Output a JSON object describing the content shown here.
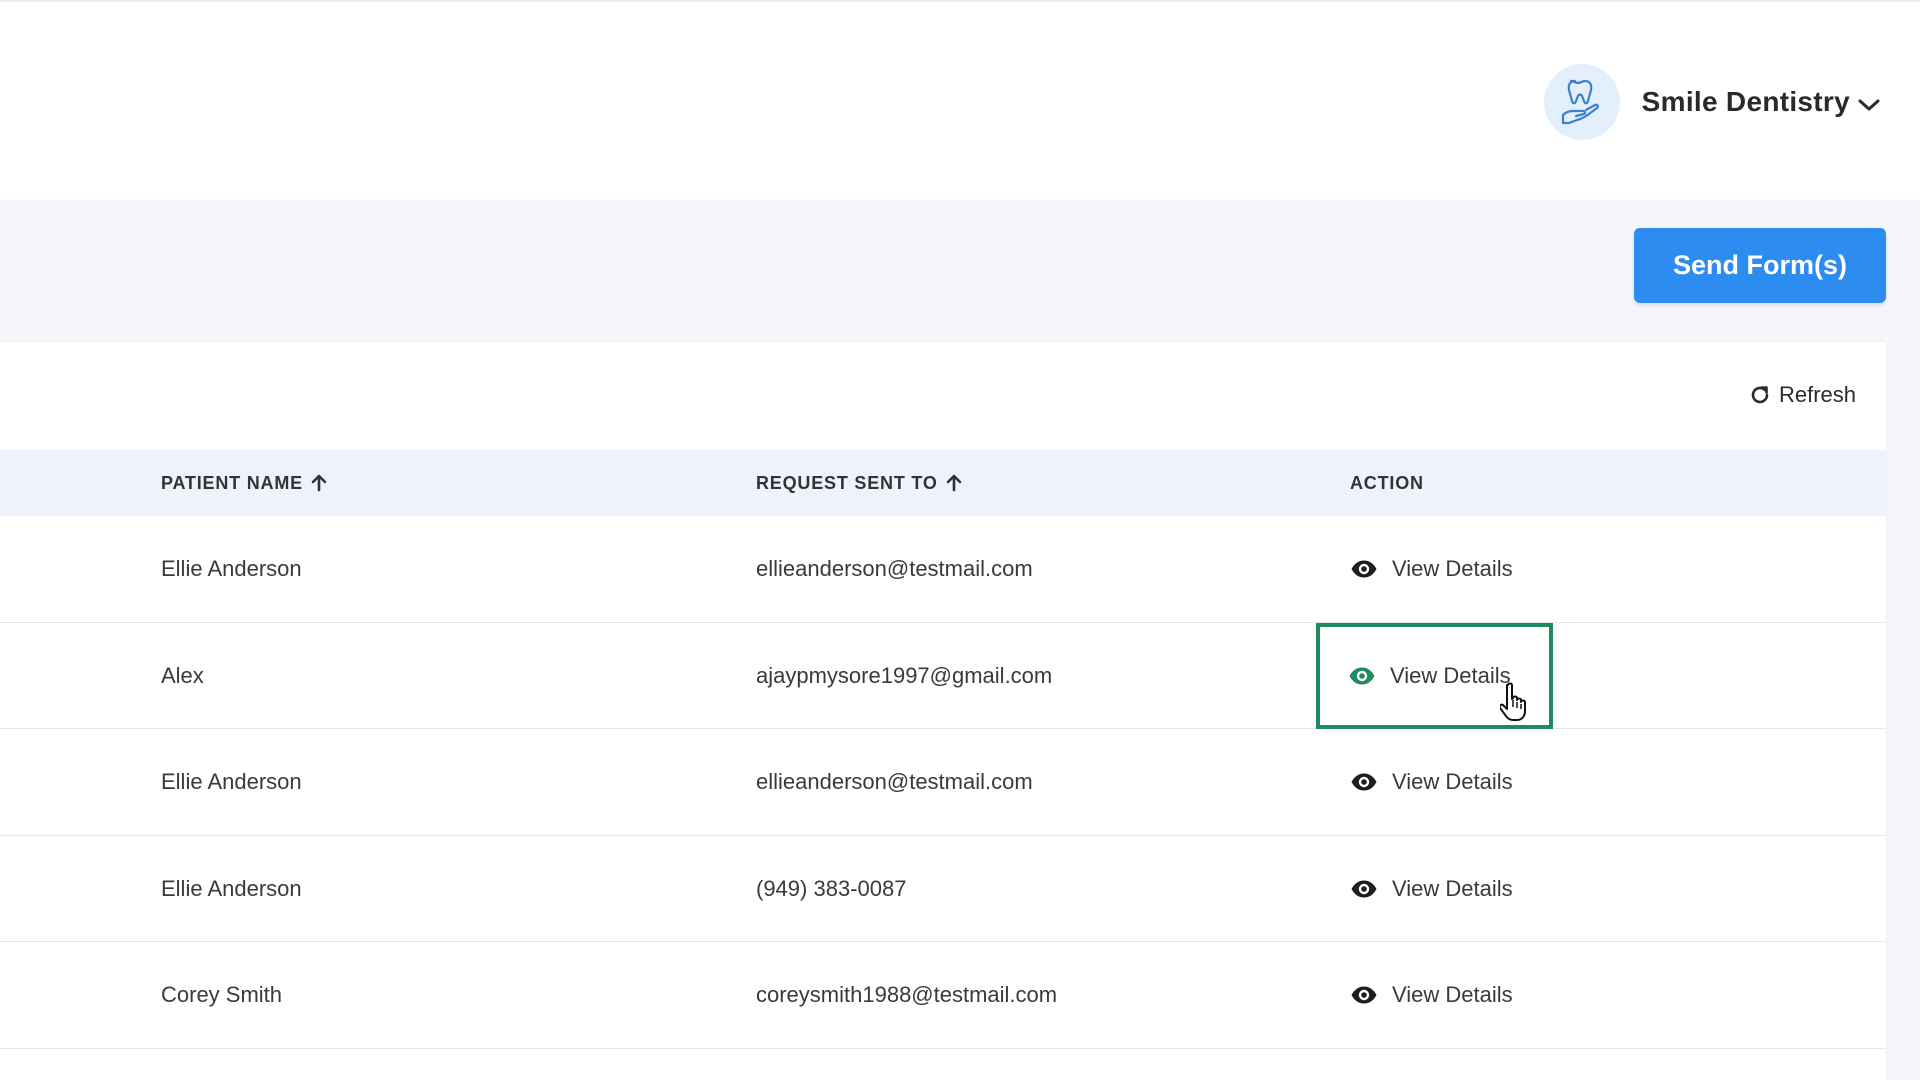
{
  "header": {
    "brand_name": "Smile Dentistry",
    "logo_icon": "tooth-in-hand-icon",
    "dropdown_icon": "chevron-down-icon"
  },
  "toolbar": {
    "send_forms_label": "Send Form(s)",
    "accent_color": "#2d8cf0"
  },
  "table": {
    "refresh_label": "Refresh",
    "columns": [
      {
        "label": "PATIENT NAME",
        "sortable": true
      },
      {
        "label": "REQUEST SENT TO",
        "sortable": true
      },
      {
        "label": "ACTION",
        "sortable": false
      }
    ],
    "rows": [
      {
        "patient": "Ellie Anderson",
        "sent_to": "ellieanderson@testmail.com",
        "action": "View Details"
      },
      {
        "patient": "Alex",
        "sent_to": "ajaypmysore1997@gmail.com",
        "action": "View Details"
      },
      {
        "patient": "Ellie Anderson",
        "sent_to": "ellieanderson@testmail.com",
        "action": "View Details"
      },
      {
        "patient": "Ellie Anderson",
        "sent_to": "(949) 383-0087",
        "action": "View Details"
      },
      {
        "patient": "Corey Smith",
        "sent_to": "coreysmith1988@testmail.com",
        "action": "View Details"
      }
    ],
    "highlight_color": "#1f8a5e"
  }
}
